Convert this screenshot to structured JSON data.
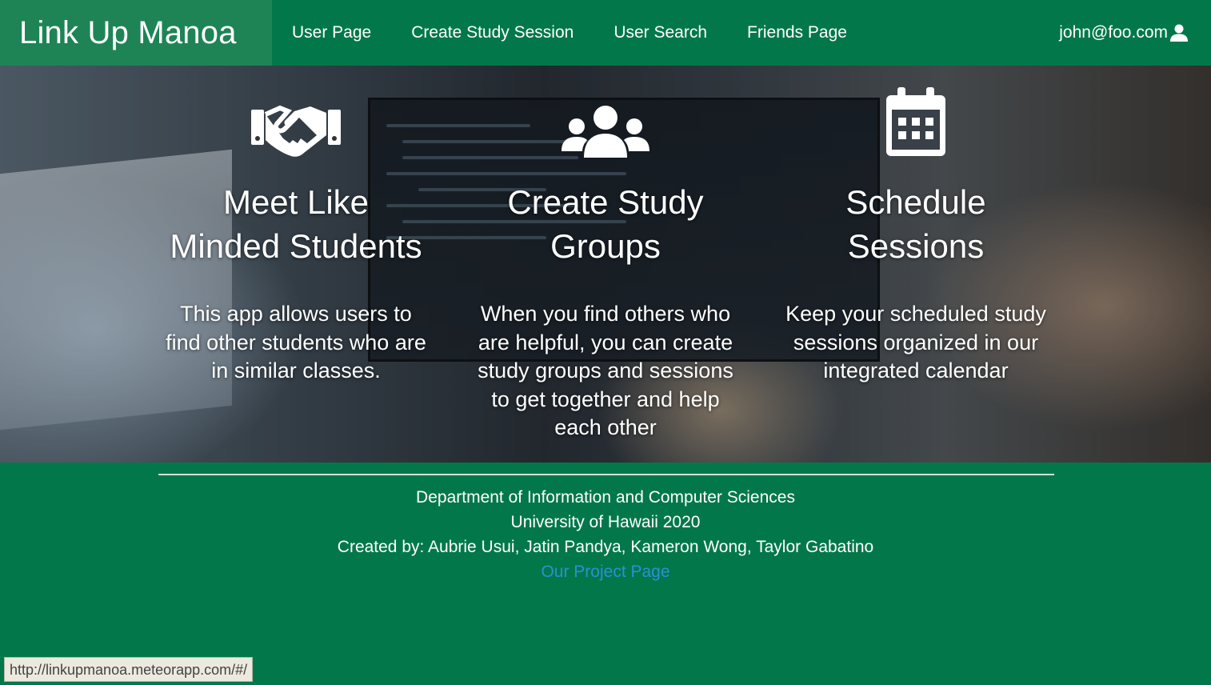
{
  "navbar": {
    "brand": "Link Up Manoa",
    "items": [
      {
        "label": "User Page"
      },
      {
        "label": "Create Study Session"
      },
      {
        "label": "User Search"
      },
      {
        "label": "Friends Page"
      }
    ],
    "user": {
      "email": "john@foo.com",
      "icon": "user-icon"
    }
  },
  "hero": {
    "features": [
      {
        "icon": "handshake-icon",
        "title_line1": "Meet Like",
        "title_line2": "Minded Students",
        "body_lines": [
          "This app allows users to",
          "find other students who are",
          "in similar classes."
        ]
      },
      {
        "icon": "users-icon",
        "title_line1": "Create Study",
        "title_line2": "Groups",
        "body_lines": [
          "When you find others who",
          "are helpful, you can create",
          "study groups and sessions",
          "to get together and help",
          "each other"
        ]
      },
      {
        "icon": "calendar-icon",
        "title_line1": "Schedule",
        "title_line2": "Sessions",
        "body_lines": [
          "Keep your scheduled study",
          "sessions organized in our",
          "integrated calendar"
        ]
      }
    ]
  },
  "footer": {
    "line1": "Department of Information and Computer Sciences",
    "line2": "University of Hawaii 2020",
    "line3": "Created by: Aubrie Usui, Jatin Pandya, Kameron Wong, Taylor Gabatino",
    "link": "Our Project Page"
  },
  "status_bar": {
    "url": "http://linkupmanoa.meteorapp.com/#/"
  },
  "colors": {
    "brand_green": "#02784a",
    "brand_highlight": "#1e8456",
    "link_blue": "#2c8fd6"
  }
}
